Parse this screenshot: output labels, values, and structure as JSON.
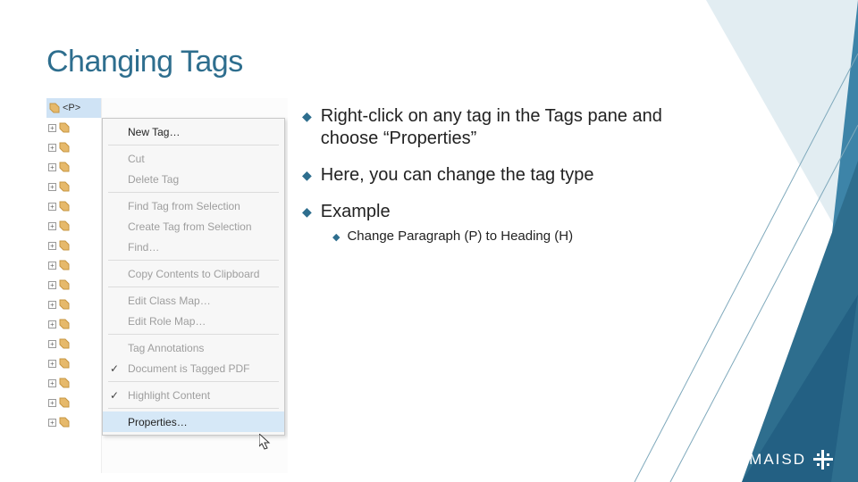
{
  "title": "Changing Tags",
  "bullets": {
    "b1": "Right-click on any tag in the Tags pane and choose “Properties”",
    "b2": "Here, you can change the tag type",
    "b3": "Example",
    "sub1": "Change Paragraph (P) to Heading (H)"
  },
  "tree": {
    "first_label": "<P>"
  },
  "context_menu": {
    "items": [
      {
        "label": "New Tag…",
        "enabled": true,
        "sep_after": true
      },
      {
        "label": "Cut",
        "enabled": false,
        "sep_after": false
      },
      {
        "label": "Delete Tag",
        "enabled": false,
        "sep_after": true
      },
      {
        "label": "Find Tag from Selection",
        "enabled": false,
        "sep_after": false
      },
      {
        "label": "Create Tag from Selection",
        "enabled": false,
        "sep_after": false
      },
      {
        "label": "Find…",
        "enabled": false,
        "sep_after": true
      },
      {
        "label": "Copy Contents to Clipboard",
        "enabled": false,
        "sep_after": true
      },
      {
        "label": "Edit Class Map…",
        "enabled": false,
        "sep_after": false
      },
      {
        "label": "Edit Role Map…",
        "enabled": false,
        "sep_after": true
      },
      {
        "label": "Tag Annotations",
        "enabled": false,
        "sep_after": false
      },
      {
        "label": "Document is Tagged PDF",
        "enabled": false,
        "sep_after": true,
        "checked": true
      },
      {
        "label": "Highlight Content",
        "enabled": false,
        "sep_after": true,
        "checked": true
      },
      {
        "label": "Properties…",
        "enabled": true,
        "sep_after": false,
        "hover": true
      }
    ]
  },
  "logo_text": "MAISD"
}
